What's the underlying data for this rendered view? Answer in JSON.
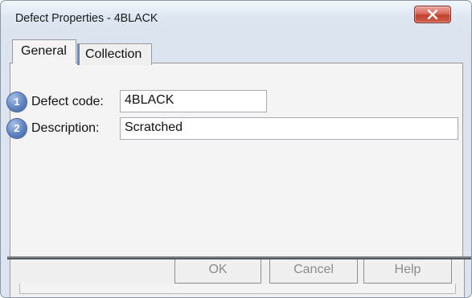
{
  "window": {
    "title": "Defect Properties - 4BLACK"
  },
  "tabs": [
    {
      "label": "General",
      "selected": true
    },
    {
      "label": "Collection",
      "selected": false
    }
  ],
  "fields": {
    "defect_code": {
      "badge": "1",
      "label": "Defect code:",
      "value": "4BLACK"
    },
    "description": {
      "badge": "2",
      "label": "Description:",
      "value": "Scratched"
    }
  },
  "buttons": {
    "ok": "OK",
    "cancel": "Cancel",
    "help": "Help"
  },
  "colors": {
    "close_button": "#c2412f",
    "badge": "#5f83c1",
    "disabled_text": "#8c8c8c"
  },
  "icons": {
    "close": "close-icon"
  }
}
